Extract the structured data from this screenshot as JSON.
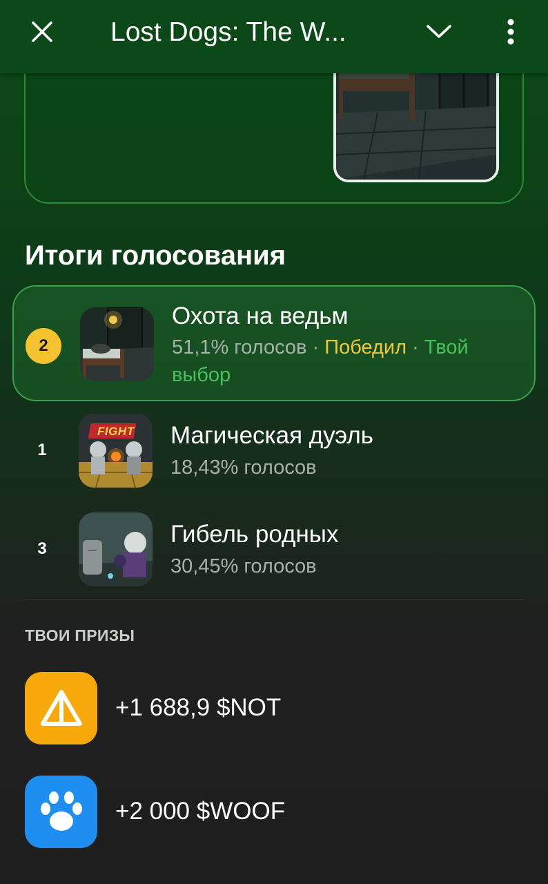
{
  "header": {
    "title": "Lost Dogs: The W...",
    "close_icon": "close-icon",
    "chevron_icon": "chevron-down-icon",
    "more_icon": "more-vertical-icon"
  },
  "voting": {
    "title": "Итоги голосования",
    "options": [
      {
        "rank": "2",
        "name": "Охота на ведьм",
        "percent": "51,1% голосов",
        "sep1": " · ",
        "status": "Победил",
        "sep2": " · ",
        "choice": "Твой выбор",
        "selected": true
      },
      {
        "rank": "1",
        "name": "Магическая дуэль",
        "percent": "18,43% голосов",
        "thumb_text": "FIGHT"
      },
      {
        "rank": "3",
        "name": "Гибель родных",
        "percent": "30,45% голосов"
      }
    ]
  },
  "prizes": {
    "title": "ТВОИ ПРИЗЫ",
    "items": [
      {
        "text": "+1 688,9 $NOT",
        "icon": "notcoin-icon",
        "color": "#f7a80a"
      },
      {
        "text": "+2 000 $WOOF",
        "icon": "paw-icon",
        "color": "#1e8ff0"
      }
    ]
  },
  "colors": {
    "accent_green": "#45c35a",
    "winner_yellow": "#f4c534",
    "header_bg": "#0b4a18"
  }
}
